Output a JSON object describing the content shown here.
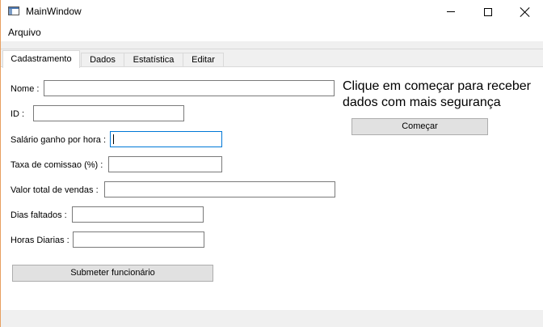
{
  "window": {
    "title": "MainWindow"
  },
  "menubar": {
    "file": "Arquivo"
  },
  "tabs": [
    {
      "label": "Cadastramento",
      "active": true
    },
    {
      "label": "Dados",
      "active": false
    },
    {
      "label": "Estatística",
      "active": false
    },
    {
      "label": "Editar",
      "active": false
    }
  ],
  "form": {
    "nome_label": "Nome :",
    "nome_value": "",
    "id_label": "ID :",
    "id_value": "",
    "salario_label": "Salário ganho por hora :",
    "salario_value": "",
    "taxa_label": "Taxa de comissao (%) :",
    "taxa_value": "",
    "vendas_label": "Valor total de vendas :",
    "vendas_value": "",
    "dias_label": "Dias faltados :",
    "dias_value": "",
    "horas_label": "Horas Diarias :",
    "horas_value": "",
    "submit_label": "Submeter funcionário"
  },
  "side": {
    "info": "Clique em começar para receber dados com mais segurança",
    "start_label": "Começar"
  },
  "colors": {
    "focus": "#0078d7",
    "button_bg": "#e1e1e1",
    "window_border": "#e8a060"
  }
}
